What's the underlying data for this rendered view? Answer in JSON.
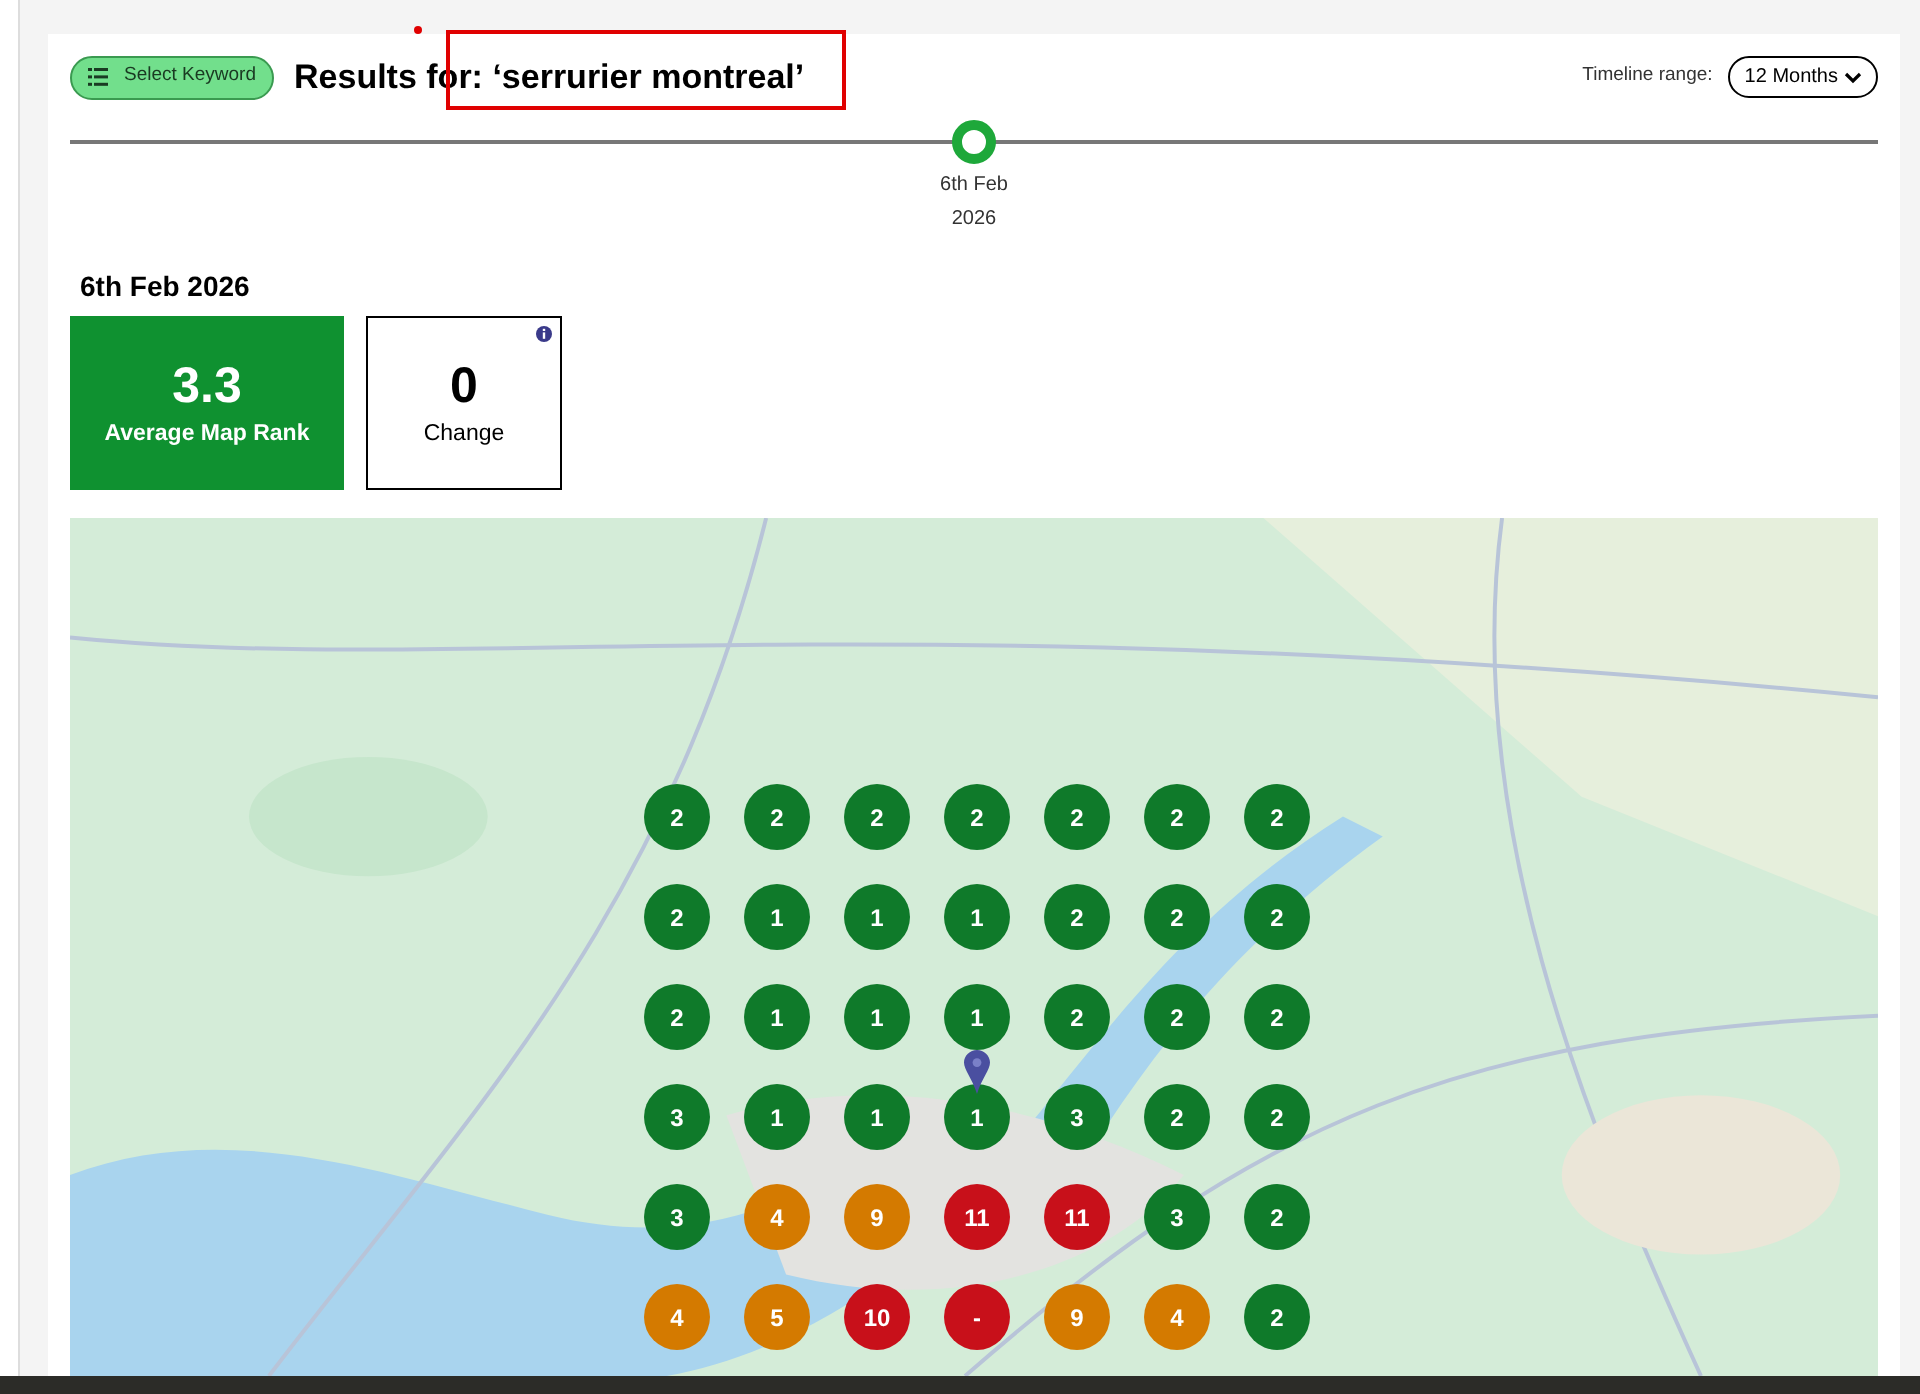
{
  "keyword_button": {
    "label": "Select Keyword"
  },
  "title": "Results for: ‘serrurier montreal’",
  "timeline_range": {
    "label": "Timeline range:",
    "value": "12 Months"
  },
  "timeline": {
    "points": [
      {
        "label": "6th Feb 2026",
        "selected": true
      }
    ]
  },
  "date_heading": "6th Feb 2026",
  "stats": [
    {
      "kind": "highlight",
      "value": "3.3",
      "label": "Average Map Rank"
    },
    {
      "kind": "outline",
      "value": "0",
      "label": "Change"
    }
  ],
  "rank_grid": [
    [
      {
        "rank": "2",
        "color": "#0f7a2a"
      },
      {
        "rank": "2",
        "color": "#0f7a2a"
      },
      {
        "rank": "2",
        "color": "#0f7a2a"
      },
      {
        "rank": "2",
        "color": "#0f7a2a"
      },
      {
        "rank": "2",
        "color": "#0f7a2a"
      },
      {
        "rank": "2",
        "color": "#0f7a2a"
      },
      {
        "rank": "2",
        "color": "#0f7a2a"
      }
    ],
    [
      {
        "rank": "2",
        "color": "#0f7a2a"
      },
      {
        "rank": "1",
        "color": "#0f7a2a"
      },
      {
        "rank": "1",
        "color": "#0f7a2a"
      },
      {
        "rank": "1",
        "color": "#0f7a2a"
      },
      {
        "rank": "2",
        "color": "#0f7a2a"
      },
      {
        "rank": "2",
        "color": "#0f7a2a"
      },
      {
        "rank": "2",
        "color": "#0f7a2a"
      }
    ],
    [
      {
        "rank": "2",
        "color": "#0f7a2a"
      },
      {
        "rank": "1",
        "color": "#0f7a2a"
      },
      {
        "rank": "1",
        "color": "#0f7a2a"
      },
      {
        "rank": "1",
        "color": "#0f7a2a"
      },
      {
        "rank": "2",
        "color": "#0f7a2a"
      },
      {
        "rank": "2",
        "color": "#0f7a2a"
      },
      {
        "rank": "2",
        "color": "#0f7a2a"
      }
    ],
    [
      {
        "rank": "3",
        "color": "#0f7a2a"
      },
      {
        "rank": "1",
        "color": "#0f7a2a"
      },
      {
        "rank": "1",
        "color": "#0f7a2a"
      },
      {
        "rank": "1",
        "color": "#0f7a2a",
        "pinned": true
      },
      {
        "rank": "3",
        "color": "#0f7a2a"
      },
      {
        "rank": "2",
        "color": "#0f7a2a"
      },
      {
        "rank": "2",
        "color": "#0f7a2a"
      }
    ],
    [
      {
        "rank": "3",
        "color": "#0f7a2a"
      },
      {
        "rank": "4",
        "color": "#d47a00"
      },
      {
        "rank": "9",
        "color": "#d47a00"
      },
      {
        "rank": "11",
        "color": "#c8101a"
      },
      {
        "rank": "11",
        "color": "#c8101a"
      },
      {
        "rank": "3",
        "color": "#0f7a2a"
      },
      {
        "rank": "2",
        "color": "#0f7a2a"
      }
    ],
    [
      {
        "rank": "4",
        "color": "#d47a00"
      },
      {
        "rank": "5",
        "color": "#d47a00"
      },
      {
        "rank": "10",
        "color": "#c8101a"
      },
      {
        "rank": "-",
        "color": "#c8101a"
      },
      {
        "rank": "9",
        "color": "#d47a00"
      },
      {
        "rank": "4",
        "color": "#d47a00"
      },
      {
        "rank": "2",
        "color": "#0f7a2a"
      }
    ]
  ]
}
